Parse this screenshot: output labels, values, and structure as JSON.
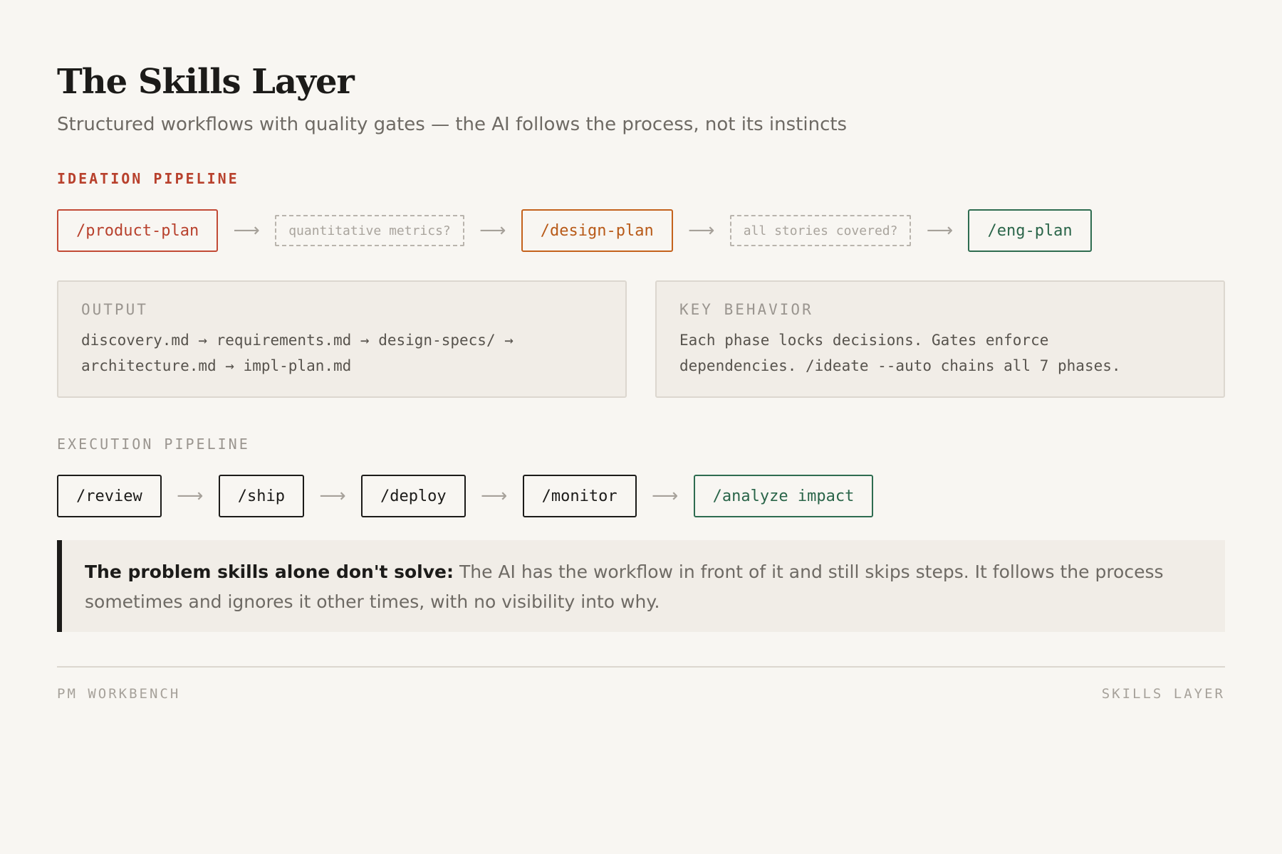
{
  "header": {
    "title": "The Skills Layer",
    "subtitle": "Structured workflows with quality gates — the AI follows the process, not its instincts"
  },
  "ideation": {
    "label": "IDEATION PIPELINE",
    "nodes": [
      "/product-plan",
      "/design-plan",
      "/eng-plan"
    ],
    "gates": [
      "quantitative metrics?",
      "all stories covered?"
    ],
    "arrow": "⟶"
  },
  "cards": {
    "output": {
      "title": "OUTPUT",
      "body": "discovery.md → requirements.md → design-specs/ →\narchitecture.md → impl-plan.md"
    },
    "behavior": {
      "title": "KEY BEHAVIOR",
      "body": "Each phase locks decisions. Gates enforce\ndependencies. /ideate --auto chains all 7 phases."
    }
  },
  "execution": {
    "label": "EXECUTION PIPELINE",
    "nodes": [
      "/review",
      "/ship",
      "/deploy",
      "/monitor",
      "/analyze impact"
    ],
    "arrow": "⟶"
  },
  "callout": {
    "strong": "The problem skills alone don't solve:",
    "text": "The AI has the workflow in front of it and still skips steps. It follows the process sometimes and ignores it other times, with no visibility into why."
  },
  "footer": {
    "left": "PM WORKBENCH",
    "right": "SKILLS LAYER"
  },
  "colors": {
    "background": "#f8f6f2",
    "ideation_accent": "#b8412d",
    "design_accent": "#b85a18",
    "success_accent": "#2a6549",
    "panel": "#f1ede7"
  }
}
